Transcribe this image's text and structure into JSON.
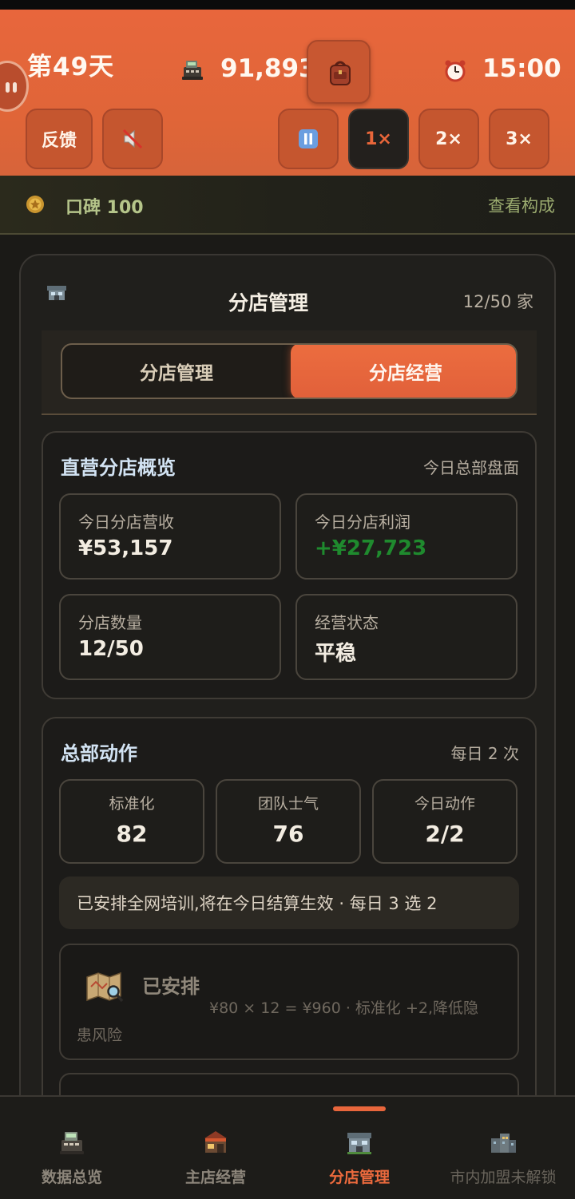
{
  "header": {
    "day": "第49天",
    "money": "91,893",
    "time": "15:00",
    "buttons": {
      "feedback": "反馈",
      "speed_1x": "1×",
      "speed_2x": "2×",
      "speed_3x": "3×"
    },
    "selected_speed": "1×"
  },
  "reputation": {
    "label": "口碑 100",
    "link": "查看构成"
  },
  "panel": {
    "title": "分店管理",
    "count": "12/50 家",
    "tabs": [
      "分店管理",
      "分店经营"
    ],
    "active_tab": "分店经营"
  },
  "overview": {
    "title": "直营分店概览",
    "subtitle": "今日总部盘面",
    "stats": [
      {
        "label": "今日分店营收",
        "value": "¥53,157"
      },
      {
        "label": "今日分店利润",
        "value": "+¥27,723"
      },
      {
        "label": "分店数量",
        "value": "12/50"
      },
      {
        "label": "经营状态",
        "value": "平稳"
      }
    ]
  },
  "hq_actions": {
    "title": "总部动作",
    "subtitle": "每日 2 次",
    "metrics": [
      {
        "label": "标准化",
        "value": "82"
      },
      {
        "label": "团队士气",
        "value": "76"
      },
      {
        "label": "今日动作",
        "value": "2/2"
      }
    ],
    "notice": "已安排全网培训,将在今日结算生效 · 每日 3 选 2",
    "action": {
      "status": "已安排",
      "desc_line1": "¥80 × 12 = ¥960 · 标准化 +2,降低隐",
      "desc_line2": "患风险"
    }
  },
  "bottom_nav": {
    "items": [
      "数据总览",
      "主店经营",
      "分店管理",
      "市内加盟未解锁"
    ],
    "active": "分店管理"
  },
  "colors": {
    "accent": "#e8663c",
    "profit_green": "#1f8a2e",
    "title_blue": "#d2e3f3"
  }
}
